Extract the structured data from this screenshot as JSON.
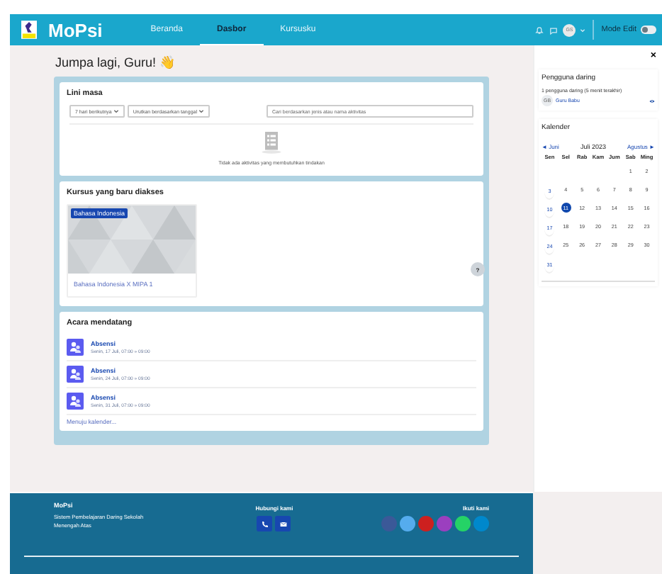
{
  "header": {
    "brand": "MoPsi",
    "nav": [
      {
        "label": "Beranda",
        "selected": false
      },
      {
        "label": "Dasbor",
        "selected": true
      },
      {
        "label": "Kursusku",
        "selected": false
      }
    ],
    "avatar": "GS",
    "edit_mode": {
      "label": "Mode Edit",
      "on": false
    }
  },
  "greeting": "Jumpa lagi, Guru! 👋",
  "timeline": {
    "title": "Lini masa",
    "filters": [
      "7 hari berikutnya",
      "Urutkan berdasarkan tanggal"
    ],
    "search": {
      "placeholder": "Cari berdasarkan jenis atau nama aktivitas"
    },
    "empty": "Tidak ada aktivitas yang membutuhkan tindakan"
  },
  "recent_courses": {
    "title": "Kursus yang baru diakses",
    "courses": [
      {
        "category": "Bahasa Indonesia",
        "name": "Bahasa Indonesia X MIPA 1"
      }
    ]
  },
  "upcoming": {
    "title": "Acara mendatang",
    "events": [
      {
        "title": "Absensi",
        "date": "Senin, 17 Juli, 07:00 » 09:00"
      },
      {
        "title": "Absensi",
        "date": "Senin, 24 Juli, 07:00 » 09:00"
      },
      {
        "title": "Absensi",
        "date": "Senin, 31 Juli, 07:00 » 09:00"
      }
    ],
    "link": "Menuju kalender..."
  },
  "help": "?",
  "drawer": {
    "close": "×",
    "online": {
      "title": "Pengguna daring",
      "summary": "1 pengguna daring (5 menit terakhir)",
      "users": [
        {
          "initials": "GB",
          "name": "Guru Babu"
        }
      ]
    },
    "calendar": {
      "title": "Kalender",
      "prev": "◄ Juni",
      "month": "Juli 2023",
      "next": "Agustus ►",
      "weekdays": [
        "Sen",
        "Sel",
        "Rab",
        "Kam",
        "Jum",
        "Sab",
        "Ming"
      ],
      "weeks": [
        [
          {
            "day": "1",
            "event": false,
            "today": false
          },
          {
            "day": "2",
            "event": false,
            "today": false
          }
        ],
        [
          {
            "day": "3",
            "event": true,
            "today": false
          },
          {
            "day": "4",
            "event": false,
            "today": false
          },
          {
            "day": "5",
            "event": false,
            "today": false
          },
          {
            "day": "6",
            "event": false,
            "today": false
          },
          {
            "day": "7",
            "event": false,
            "today": false
          },
          {
            "day": "8",
            "event": false,
            "today": false
          },
          {
            "day": "9",
            "event": false,
            "today": false
          }
        ],
        [
          {
            "day": "10",
            "event": true,
            "today": false
          },
          {
            "day": "11",
            "event": false,
            "today": true
          },
          {
            "day": "12",
            "event": false,
            "today": false
          },
          {
            "day": "13",
            "event": false,
            "today": false
          },
          {
            "day": "14",
            "event": false,
            "today": false
          },
          {
            "day": "15",
            "event": false,
            "today": false
          },
          {
            "day": "16",
            "event": false,
            "today": false
          }
        ],
        [
          {
            "day": "17",
            "event": true,
            "today": false
          },
          {
            "day": "18",
            "event": false,
            "today": false
          },
          {
            "day": "19",
            "event": false,
            "today": false
          },
          {
            "day": "20",
            "event": false,
            "today": false
          },
          {
            "day": "21",
            "event": false,
            "today": false
          },
          {
            "day": "22",
            "event": false,
            "today": false
          },
          {
            "day": "23",
            "event": false,
            "today": false
          }
        ],
        [
          {
            "day": "24",
            "event": true,
            "today": false
          },
          {
            "day": "25",
            "event": false,
            "today": false
          },
          {
            "day": "26",
            "event": false,
            "today": false
          },
          {
            "day": "27",
            "event": false,
            "today": false
          },
          {
            "day": "28",
            "event": false,
            "today": false
          },
          {
            "day": "29",
            "event": false,
            "today": false
          },
          {
            "day": "30",
            "event": false,
            "today": false
          }
        ],
        [
          {
            "day": "31",
            "event": true,
            "today": false
          }
        ]
      ]
    }
  },
  "footer": {
    "brand": "MoPsi",
    "tagline": "Sistem Pembelajaran Daring Sekolah Menengah Atas",
    "contact_title": "Hubungi kami",
    "follow_title": "Ikuti kami",
    "social": [
      {
        "color": "#3b5998"
      },
      {
        "color": "#55acee"
      },
      {
        "color": "#cd201f"
      },
      {
        "color": "#9b3fbf"
      },
      {
        "color": "#25d366"
      },
      {
        "color": "#0088cc"
      }
    ]
  }
}
